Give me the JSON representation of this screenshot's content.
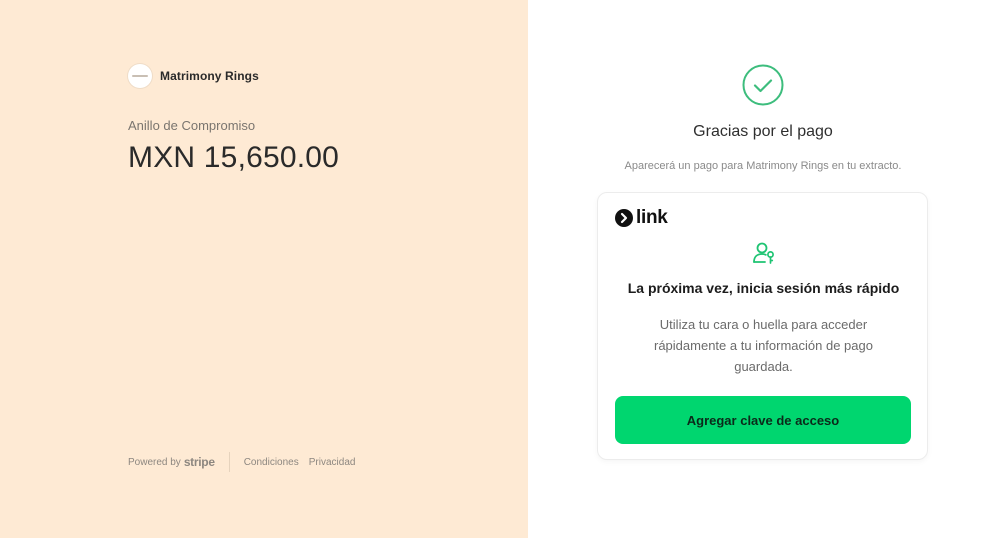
{
  "merchant": {
    "name": "Matrimony Rings",
    "logo_icon": "merchant-logo"
  },
  "product": {
    "name": "Anillo de Compromiso",
    "amount": "MXN 15,650.00"
  },
  "footer": {
    "powered_by": "Powered by",
    "stripe": "stripe",
    "terms": "Condiciones",
    "privacy": "Privacidad"
  },
  "confirmation": {
    "icon": "check-circle-icon",
    "title": "Gracias por el pago",
    "statement_note": "Aparecerá un pago para Matrimony Rings en tu extracto."
  },
  "link_card": {
    "brand": "link",
    "brand_icon": "link-arrow-icon",
    "icon": "user-key-icon",
    "heading": "La próxima vez, inicia sesión más rápido",
    "description": "Utiliza tu cara o huella para acceder rápidamente a tu información de pago guardada.",
    "button_label": "Agregar clave de acceso"
  },
  "colors": {
    "left_background": "#feead4",
    "success_green": "#3dbd7d",
    "link_green": "#00d66f"
  }
}
